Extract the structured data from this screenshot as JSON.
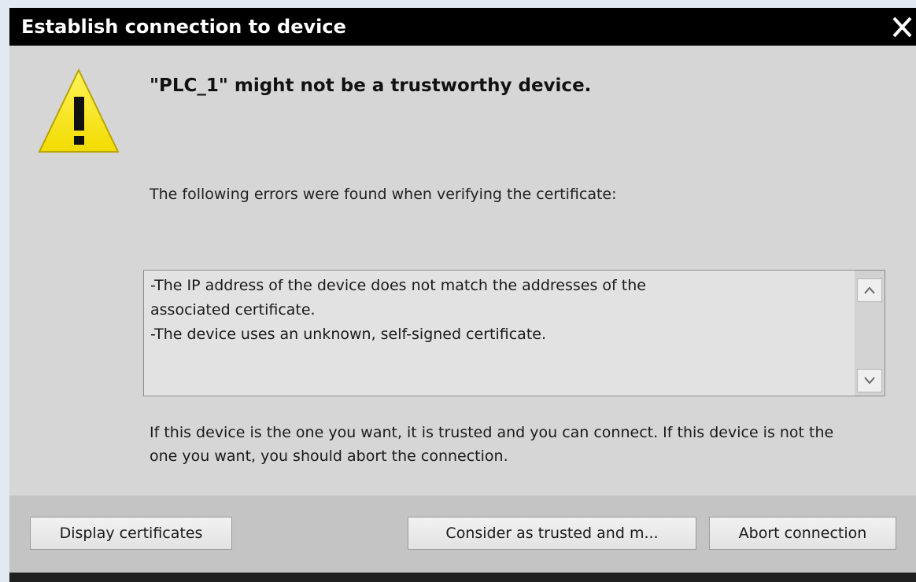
{
  "dialog": {
    "title": "Establish connection to device",
    "close_icon": "close-icon",
    "warning_icon": "warning-triangle-icon",
    "headline": "\"PLC_1\" might not be a trustworthy device.",
    "intro": "The following errors were found when verifying the certificate:",
    "errors": [
      "-The IP address of the device does not match the addresses of the",
      "associated certificate.",
      "-The device uses an unknown, self-signed certificate."
    ],
    "advice": "If this device is the one you want, it is trusted and you can connect. If this device is not the one you want, you should abort the connection.",
    "buttons": {
      "display_certificates": "Display certificates",
      "consider_trusted": "Consider as trusted and m...",
      "abort": "Abort connection"
    }
  },
  "colors": {
    "title_bar": "#000000",
    "dialog_background": "#d6d6d6",
    "warning_yellow": "#f5e600"
  }
}
